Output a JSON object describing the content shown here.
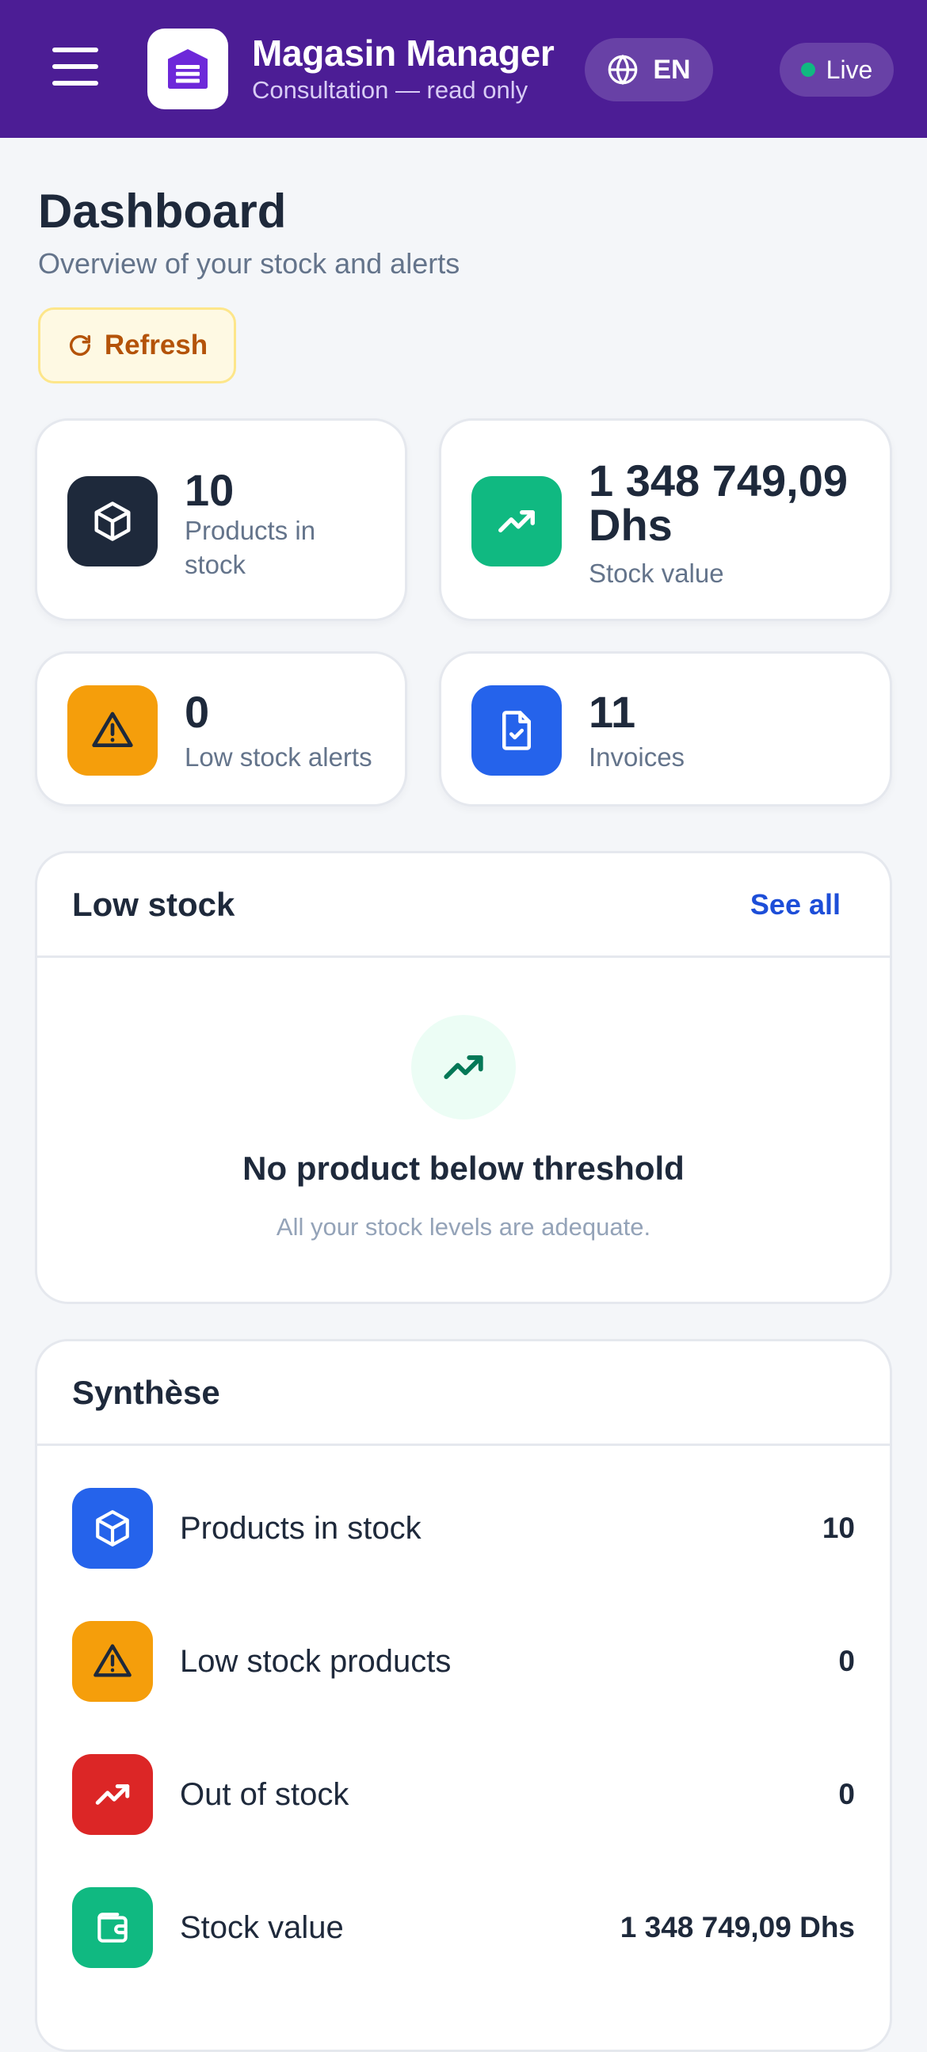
{
  "header": {
    "menu_icon": "hamburger-menu-icon",
    "logo_icon": "warehouse-icon",
    "title": "Magasin Manager",
    "subtitle": "Consultation — read only",
    "language": "EN",
    "language_icon": "globe-icon",
    "status": "Live",
    "status_color": "#10b981",
    "brand_color": "#4c1d95"
  },
  "page": {
    "title": "Dashboard",
    "subtitle": "Overview of your stock and alerts",
    "refresh_label": "Refresh"
  },
  "stats": [
    {
      "value": "10",
      "label": "Products in stock",
      "icon": "box-icon",
      "color": "#1e293b"
    },
    {
      "value": "1 348 749,09 Dhs",
      "label": "Stock value",
      "icon": "trending-up-icon",
      "color": "#10b981"
    },
    {
      "value": "0",
      "label": "Low stock alerts",
      "icon": "warning-icon",
      "color": "#f59e0b"
    },
    {
      "value": "11",
      "label": "Invoices",
      "icon": "file-check-icon",
      "color": "#2563eb"
    }
  ],
  "low_stock": {
    "title": "Low stock",
    "see_all": "See all",
    "empty_icon": "trending-up-icon",
    "empty_title": "No product below threshold",
    "empty_text": "All your stock levels are adequate."
  },
  "synthese": {
    "title": "Synthèse",
    "rows": [
      {
        "label": "Products in stock",
        "value": "10",
        "icon": "box-icon",
        "color": "#2563eb"
      },
      {
        "label": "Low stock products",
        "value": "0",
        "icon": "warning-icon",
        "color": "#f59e0b"
      },
      {
        "label": "Out of stock",
        "value": "0",
        "icon": "trending-up-icon",
        "color": "#dc2626"
      },
      {
        "label": "Stock value",
        "value": "1 348 749,09 Dhs",
        "icon": "wallet-icon",
        "color": "#10b981"
      }
    ]
  }
}
